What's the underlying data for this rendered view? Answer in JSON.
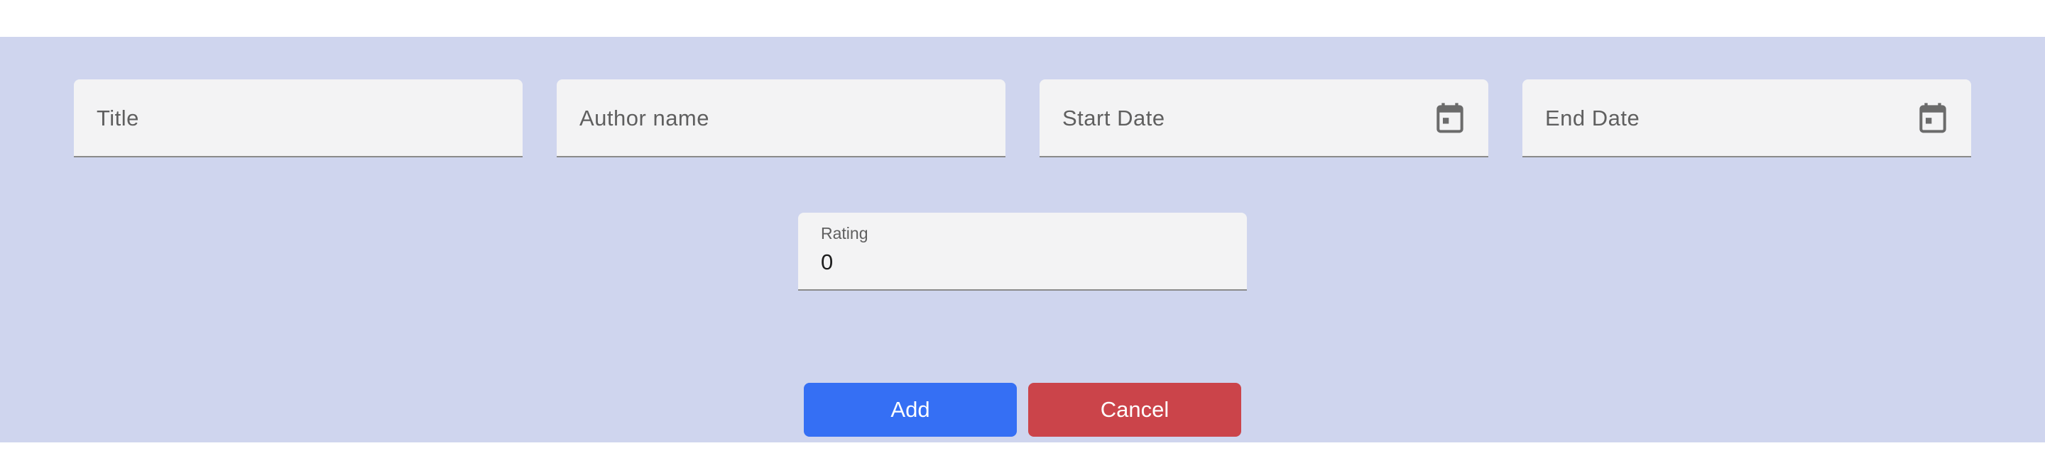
{
  "form": {
    "title_placeholder": "Title",
    "author_placeholder": "Author name",
    "start_date_placeholder": "Start Date",
    "end_date_placeholder": "End Date",
    "rating_label": "Rating",
    "rating_value": "0"
  },
  "actions": {
    "add_label": "Add",
    "cancel_label": "Cancel"
  },
  "colors": {
    "panel_background": "#cfd5ee",
    "field_background": "#f3f3f4",
    "add_button": "#356ff4",
    "cancel_button": "#cb444a"
  },
  "icons": {
    "start_date": "calendar-icon",
    "end_date": "calendar-icon"
  }
}
